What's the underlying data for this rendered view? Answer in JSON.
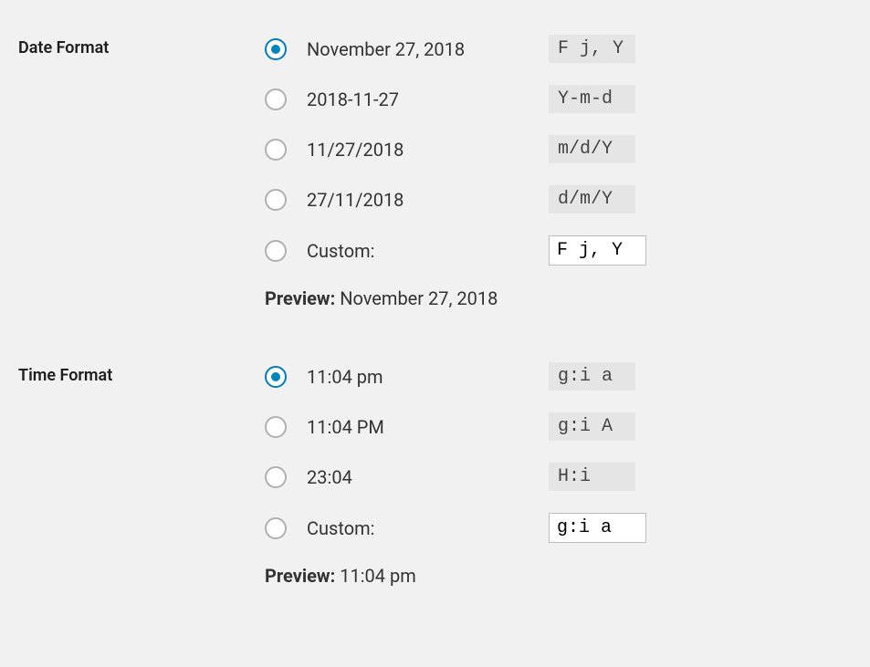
{
  "dateFormat": {
    "heading": "Date Format",
    "options": [
      {
        "label": "November 27, 2018",
        "code": "F j, Y",
        "checked": true
      },
      {
        "label": "2018-11-27",
        "code": "Y-m-d",
        "checked": false
      },
      {
        "label": "11/27/2018",
        "code": "m/d/Y",
        "checked": false
      },
      {
        "label": "27/11/2018",
        "code": "d/m/Y",
        "checked": false
      }
    ],
    "customLabel": "Custom:",
    "customValue": "F j, Y",
    "previewLabel": "Preview:",
    "previewValue": "November 27, 2018"
  },
  "timeFormat": {
    "heading": "Time Format",
    "options": [
      {
        "label": "11:04 pm",
        "code": "g:i a",
        "checked": true
      },
      {
        "label": "11:04 PM",
        "code": "g:i A",
        "checked": false
      },
      {
        "label": "23:04",
        "code": "H:i",
        "checked": false
      }
    ],
    "customLabel": "Custom:",
    "customValue": "g:i a",
    "previewLabel": "Preview:",
    "previewValue": "11:04 pm"
  }
}
